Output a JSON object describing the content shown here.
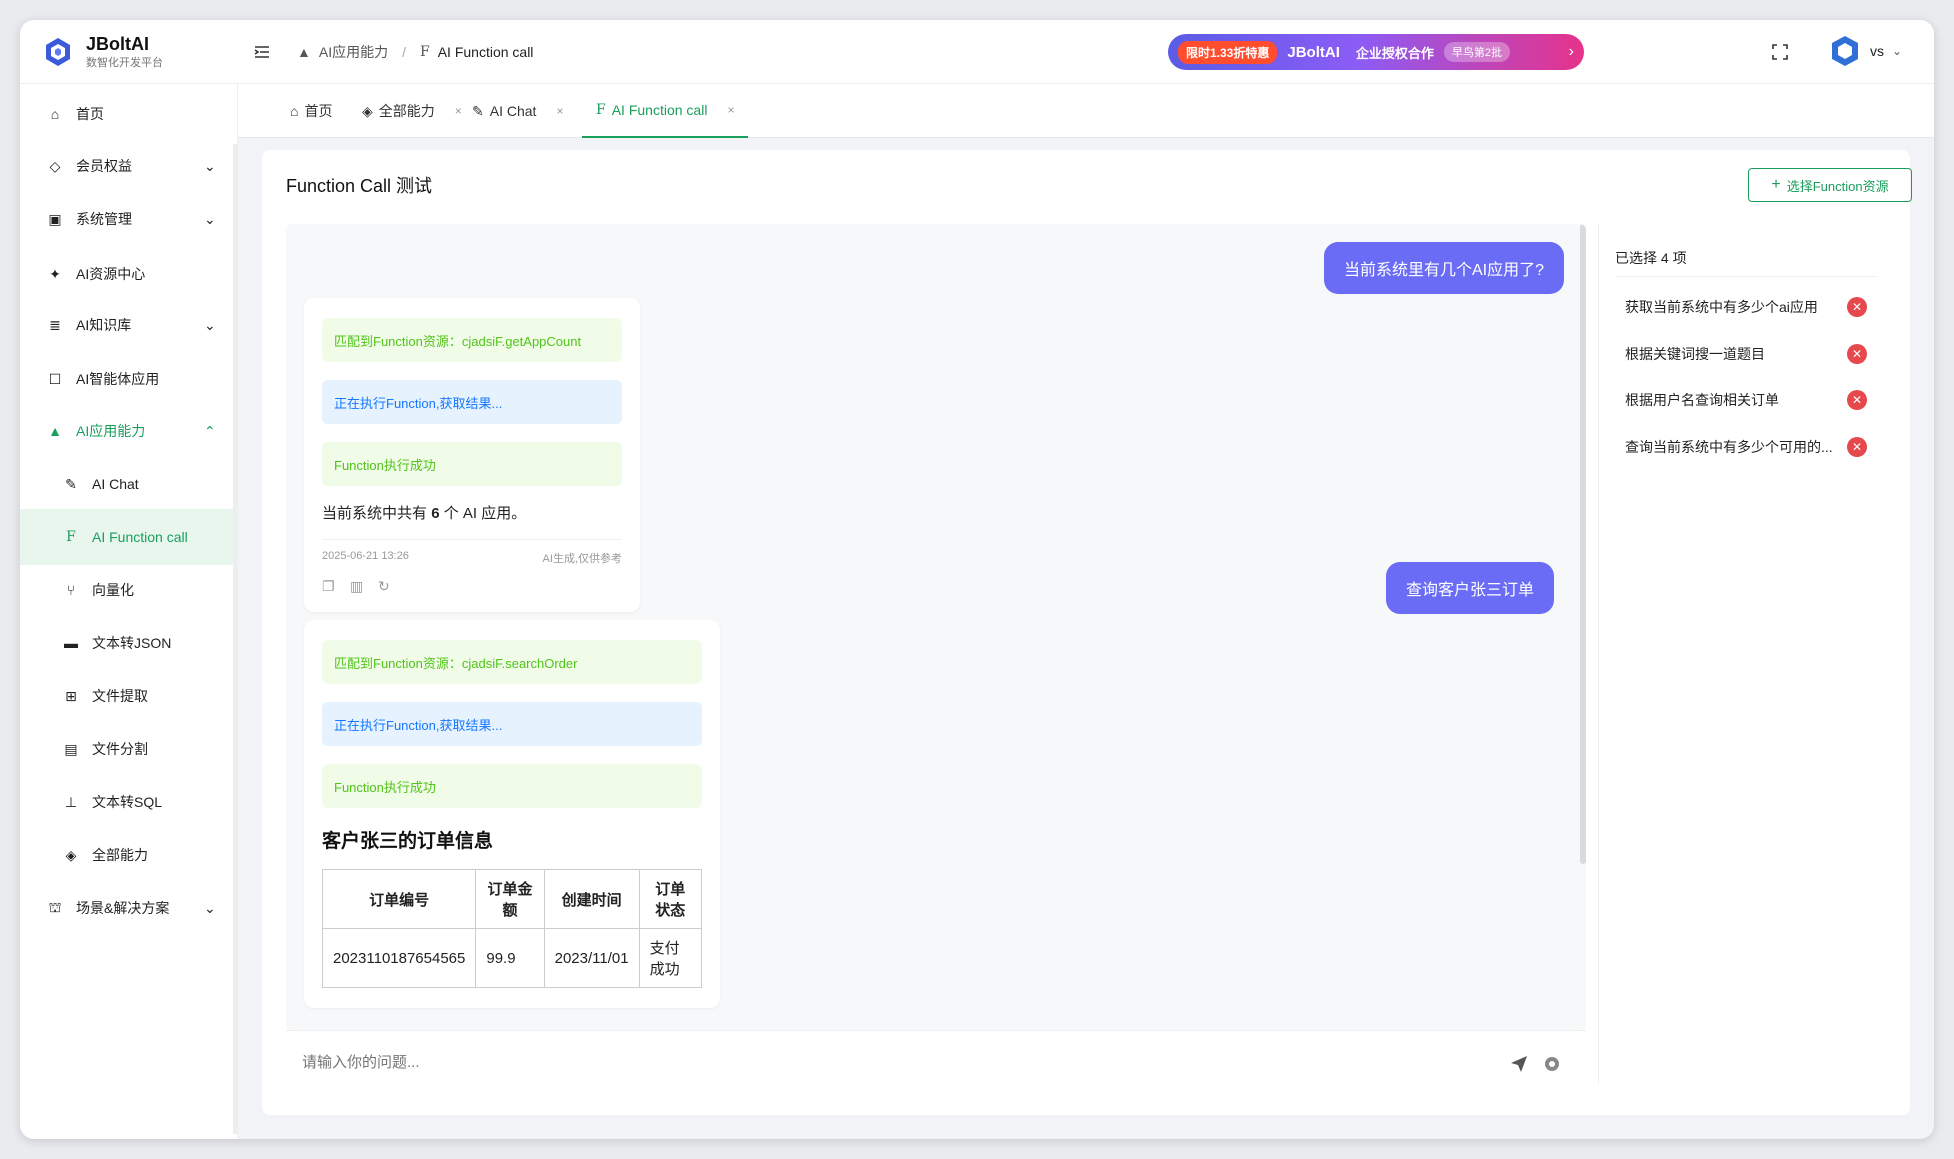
{
  "header": {
    "app_name": "JBoltAI",
    "app_subtitle": "数智化开发平台",
    "breadcrumb": [
      "AI应用能力",
      "AI Function call"
    ],
    "promo": {
      "badge": "限时1.33折特惠",
      "brand": "JBoltAI",
      "text": "企业授权合作",
      "tag": "早鸟第2批",
      "colors": {
        "start": "#5b5ce6",
        "end": "#e6338a",
        "badge": "#ff4d2e"
      }
    },
    "user_name": "vs"
  },
  "sidebar": {
    "items": [
      {
        "label": "首页",
        "icon": "home-icon"
      },
      {
        "label": "会员权益",
        "icon": "diamond-icon",
        "expandable": true
      },
      {
        "label": "系统管理",
        "icon": "settings-box-icon",
        "expandable": true
      },
      {
        "label": "AI资源中心",
        "icon": "sparkle-icon"
      },
      {
        "label": "AI知识库",
        "icon": "database-icon",
        "expandable": true
      },
      {
        "label": "AI智能体应用",
        "icon": "robot-icon"
      },
      {
        "label": "AI应用能力",
        "icon": "rocket-icon",
        "expandable": true,
        "expanded": true
      },
      {
        "label": "AI Chat",
        "icon": "chat-icon",
        "sub": true
      },
      {
        "label": "AI Function call",
        "icon": "function-icon",
        "sub": true,
        "selected": true
      },
      {
        "label": "向量化",
        "icon": "branch-icon",
        "sub": true
      },
      {
        "label": "文本转JSON",
        "icon": "json-icon",
        "sub": true
      },
      {
        "label": "文件提取",
        "icon": "file-extract-icon",
        "sub": true
      },
      {
        "label": "文件分割",
        "icon": "file-split-icon",
        "sub": true
      },
      {
        "label": "文本转SQL",
        "icon": "sql-icon",
        "sub": true
      },
      {
        "label": "全部能力",
        "icon": "cube-icon",
        "sub": true
      },
      {
        "label": "场景&解决方案",
        "icon": "scene-icon",
        "expandable": true
      }
    ]
  },
  "tabs": [
    {
      "label": "首页",
      "icon": "home-icon",
      "closable": false
    },
    {
      "label": "全部能力",
      "icon": "cube-icon",
      "closable": true
    },
    {
      "label": "AI Chat",
      "icon": "chat-icon",
      "closable": true
    },
    {
      "label": "AI Function call",
      "icon": "function-icon",
      "closable": true,
      "active": true
    }
  ],
  "main": {
    "title": "Function Call 测试",
    "select_button": "选择Function资源",
    "messages": {
      "q1": "当前系统里有几个AI应用了?",
      "a1": {
        "match": "匹配到Function资源：cjadsiF.getAppCount",
        "running": "正在执行Function,获取结果...",
        "success": "Function执行成功",
        "answer_prefix": "当前系统中共有",
        "answer_num": "6",
        "answer_suffix": "个 AI 应用。",
        "time": "2025-06-21 13:26",
        "disclaimer": "AI生成,仅供参考"
      },
      "q2": "查询客户张三订单",
      "a2": {
        "match": "匹配到Function资源：cjadsiF.searchOrder",
        "running": "正在执行Function,获取结果...",
        "success": "Function执行成功",
        "heading": "客户张三的订单信息",
        "columns": [
          "订单编号",
          "订单金额",
          "创建时间",
          "订单状态"
        ],
        "rows": [
          [
            "2023110187654565",
            "99.9",
            "2023/11/01",
            "支付成功"
          ]
        ]
      }
    },
    "input_placeholder": "请输入你的问题..."
  },
  "selected_panel": {
    "heading": "已选择 4 项",
    "items": [
      "获取当前系统中有多少个ai应用",
      "根据关键词搜一道题目",
      "根据用户名查询相关订单",
      "查询当前系统中有多少个可用的..."
    ]
  },
  "colors": {
    "accent": "#1a9e5b",
    "user_bubble": "#6a6cf6",
    "remove": "#e5484d"
  }
}
